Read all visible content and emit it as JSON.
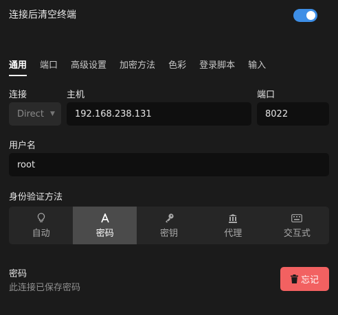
{
  "settings": {
    "clear_terminal_after_connect_label": "连接后清空终端",
    "clear_terminal_after_connect_enabled": true
  },
  "tabs": [
    {
      "label": "通用",
      "active": true
    },
    {
      "label": "端口"
    },
    {
      "label": "高级设置"
    },
    {
      "label": "加密方法"
    },
    {
      "label": "色彩"
    },
    {
      "label": "登录脚本"
    },
    {
      "label": "输入"
    }
  ],
  "connection": {
    "connection_label": "连接",
    "connection_value": "Direct",
    "host_label": "主机",
    "host_value": "192.168.238.131",
    "port_label": "端口",
    "port_value": "8022"
  },
  "username": {
    "label": "用户名",
    "value": "root"
  },
  "auth": {
    "label": "身份验证方法",
    "methods": [
      {
        "label": "自动",
        "icon": "lightbulb-icon"
      },
      {
        "label": "密码",
        "icon": "font-a-icon",
        "active": true
      },
      {
        "label": "密钥",
        "icon": "key-icon"
      },
      {
        "label": "代理",
        "icon": "agent-icon"
      },
      {
        "label": "交互式",
        "icon": "keyboard-icon"
      }
    ]
  },
  "password": {
    "label": "密码",
    "status": "此连接已保存密码",
    "forget_label": "忘记",
    "forget_icon": "trash-icon"
  },
  "colors": {
    "accent": "#3d8ee6",
    "danger": "#f26161",
    "background": "#1b1b1b"
  }
}
